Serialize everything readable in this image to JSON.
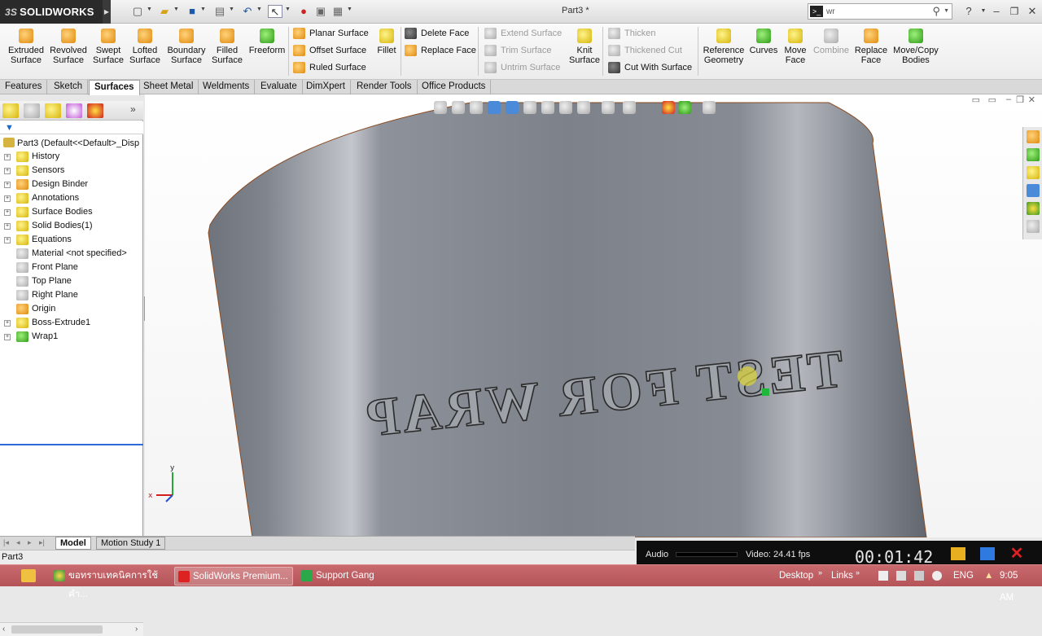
{
  "app": {
    "brand": "SOLIDWORKS",
    "brand_prefix": "3S",
    "document_title": "Part3 *",
    "search_value": "wr",
    "help_label": "?"
  },
  "commands": {
    "extruded_surface": "Extruded\nSurface",
    "revolved_surface": "Revolved\nSurface",
    "swept_surface": "Swept\nSurface",
    "lofted_surface": "Lofted\nSurface",
    "boundary_surface": "Boundary\nSurface",
    "filled_surface": "Filled\nSurface",
    "freeform": "Freeform",
    "planar_surface": "Planar Surface",
    "offset_surface": "Offset Surface",
    "ruled_surface": "Ruled Surface",
    "fillet": "Fillet",
    "delete_face": "Delete Face",
    "replace_face_small": "Replace Face",
    "extend_surface": "Extend Surface",
    "trim_surface": "Trim Surface",
    "untrim_surface": "Untrim Surface",
    "knit_surface": "Knit\nSurface",
    "thicken": "Thicken",
    "thickened_cut": "Thickened Cut",
    "cut_with_surface": "Cut With Surface",
    "reference_geometry": "Reference\nGeometry",
    "curves": "Curves",
    "move_face": "Move\nFace",
    "combine": "Combine",
    "replace_face": "Replace\nFace",
    "move_copy_bodies": "Move/Copy\nBodies"
  },
  "tabs": [
    "Features",
    "Sketch",
    "Surfaces",
    "Sheet Metal",
    "Weldments",
    "Evaluate",
    "DimXpert",
    "Render Tools",
    "Office Products"
  ],
  "active_tab": "Surfaces",
  "tree": {
    "root": "Part3  (Default<<Default>_Disp",
    "items": [
      {
        "label": "History"
      },
      {
        "label": "Sensors"
      },
      {
        "label": "Design Binder"
      },
      {
        "label": "Annotations"
      },
      {
        "label": "Surface Bodies"
      },
      {
        "label": "Solid Bodies(1)"
      },
      {
        "label": "Equations"
      },
      {
        "label": "Material <not specified>"
      },
      {
        "label": "Front Plane"
      },
      {
        "label": "Top Plane"
      },
      {
        "label": "Right Plane"
      },
      {
        "label": "Origin"
      },
      {
        "label": "Boss-Extrude1"
      },
      {
        "label": "Wrap1"
      }
    ]
  },
  "viewport": {
    "embossed_text": "TEST FOR WRAP",
    "triad_x": "x",
    "triad_y": "y"
  },
  "model_tabs": {
    "model": "Model",
    "motion_study": "Motion Study 1"
  },
  "status": {
    "text": "Part3"
  },
  "recorder": {
    "audio_label": "Audio",
    "video_label": "Video: 24.41 fps",
    "elapsed": "00:01:42"
  },
  "taskbar": {
    "app1": "ขอทราบเทคนิคการใช้คำ...",
    "app2": "SolidWorks Premium...",
    "app3": "Support Gang",
    "desktop": "Desktop",
    "links": "Links",
    "lang": "ENG",
    "time": "9:05 AM"
  },
  "colors": {
    "brand_bg": "#2a2a2a",
    "accent_blue": "#2f6bd8",
    "taskbar": "#b45458",
    "cylinder": "#8a8e96"
  }
}
